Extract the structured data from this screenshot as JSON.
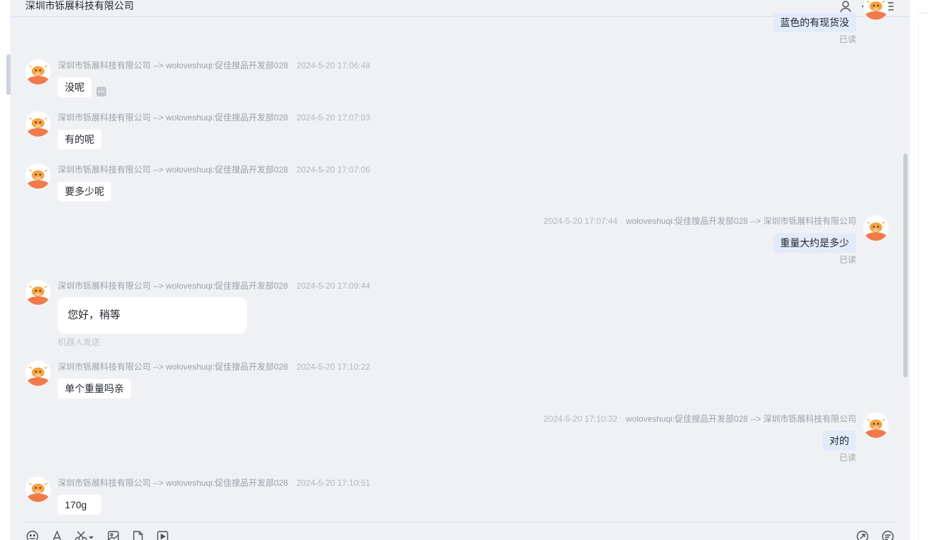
{
  "header": {
    "title": "深圳市铄展科技有限公司"
  },
  "messages": {
    "m0": {
      "text": "蓝色的有现货没",
      "read": "已读"
    },
    "m1": {
      "meta": "深圳市铄展科技有限公司 --> woloveshuqi:促佳搜品开发部028",
      "time": "2024-5-20 17:06:48",
      "text": "没呢"
    },
    "m2": {
      "meta": "深圳市铄展科技有限公司 --> woloveshuqi:促佳搜品开发部028",
      "time": "2024-5-20 17:07:03",
      "text": "有的呢"
    },
    "m3": {
      "meta": "深圳市铄展科技有限公司 --> woloveshuqi:促佳搜品开发部028",
      "time": "2024-5-20 17:07:06",
      "text": "要多少呢"
    },
    "m4": {
      "time": "2024-5-20 17:07:44",
      "meta": "woloveshuqi:促佳搜品开发部028 --> 深圳市铄展科技有限公司",
      "text": "重量大约是多少",
      "read": "已读"
    },
    "m5": {
      "meta": "深圳市铄展科技有限公司 --> woloveshuqi:促佳搜品开发部028",
      "time": "2024-5-20 17:09:44",
      "text": "您好，稍等",
      "robot": "机器人发送"
    },
    "m6": {
      "meta": "深圳市铄展科技有限公司 --> woloveshuqi:促佳搜品开发部028",
      "time": "2024-5-20 17:10:22",
      "text": "单个重量吗亲"
    },
    "m7": {
      "time": "2024-5-20 17:10:32",
      "meta": "woloveshuqi:促佳搜品开发部028 --> 深圳市铄展科技有限公司",
      "text": "对的",
      "read": "已读"
    },
    "m8": {
      "meta": "深圳市铄展科技有限公司 --> woloveshuqi:促佳搜品开发部028",
      "time": "2024-5-20 17:10:51",
      "text": "170g"
    }
  },
  "icons": {
    "header": [
      "user-icon",
      "more-icon",
      "menu-icon"
    ],
    "toolbar_left": [
      "emoji-icon",
      "font-icon",
      "screenshot-icon",
      "image-icon",
      "file-icon",
      "video-icon"
    ],
    "toolbar_right": [
      "send-history-icon",
      "quick-reply-icon"
    ]
  },
  "colors": {
    "chat_bg": "#f0f1f5",
    "incoming_bubble": "#ffffff",
    "outgoing_bubble": "#e3ebfb",
    "avatar_accent": "#f07a4a"
  }
}
